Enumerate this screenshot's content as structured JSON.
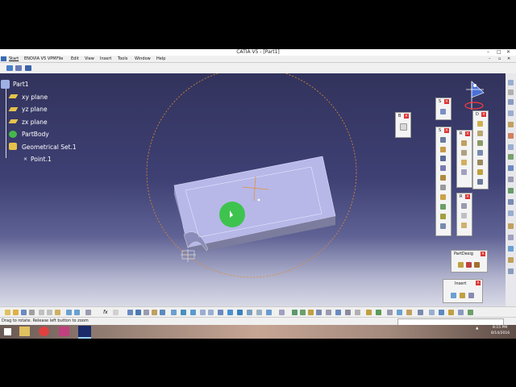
{
  "window": {
    "title": "CATIA V5 - [Part1]"
  },
  "menu": [
    "Start",
    "ENOVIA V5 VPM",
    "File",
    "Edit",
    "View",
    "Insert",
    "Tools",
    "Window",
    "Help"
  ],
  "tree": {
    "root": "Part1",
    "items": [
      "xy plane",
      "yz plane",
      "zx plane",
      "PartBody",
      "Geometrical Set.1",
      "Point.1"
    ]
  },
  "toolbars": {
    "s1": "S",
    "s2": "S",
    "d": "D",
    "r1": "R",
    "b": "B",
    "r2": "R",
    "partdesign": "PartDesig",
    "insert": "Insert"
  },
  "status": {
    "text": "Drag to rotate. Release left button to zoom"
  },
  "taskbar": {
    "time": "8:15 PM",
    "date": "8/14/2016"
  },
  "colors": {
    "viewport_top": "#32335c",
    "part_face": "#b7b8e8",
    "cursor_highlight": "#3fc34f",
    "close_button": "#dd3333"
  }
}
